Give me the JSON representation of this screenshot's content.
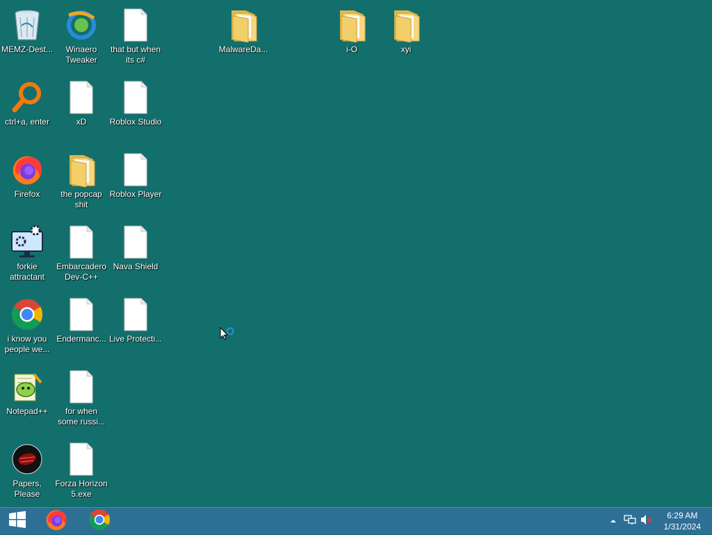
{
  "desktop": {
    "icons": [
      {
        "id": "recycle-bin",
        "label": "MEMZ-Dest...",
        "icon": "recycle-bin-icon"
      },
      {
        "id": "winaero-tweaker",
        "label": "Winaero Tweaker",
        "icon": "winaero-tweaker-icon"
      },
      {
        "id": "that-but-when",
        "label": "that but when its c#",
        "icon": "blank-file-icon"
      },
      {
        "id": "malwareda",
        "label": "MalwareDa...",
        "icon": "folder-icon"
      },
      {
        "id": "i-o",
        "label": "i-O",
        "icon": "folder-icon"
      },
      {
        "id": "xyi",
        "label": "xyi",
        "icon": "folder-icon"
      },
      {
        "id": "ctrl-a-enter",
        "label": "ctrl+a, enter",
        "icon": "magnifier-icon"
      },
      {
        "id": "xd",
        "label": "xD",
        "icon": "blank-file-icon"
      },
      {
        "id": "roblox-studio",
        "label": "Roblox Studio",
        "icon": "blank-file-icon"
      },
      {
        "id": "firefox",
        "label": "Firefox",
        "icon": "firefox-icon"
      },
      {
        "id": "popcap",
        "label": "the popcap shit",
        "icon": "folder-icon"
      },
      {
        "id": "roblox-player",
        "label": "Roblox Player",
        "icon": "blank-file-icon"
      },
      {
        "id": "forkie",
        "label": "forkie attractant",
        "icon": "monitor-gear-icon"
      },
      {
        "id": "embarcadero",
        "label": "Embarcadero Dev-C++",
        "icon": "blank-file-icon"
      },
      {
        "id": "nava-shield",
        "label": "Nava Shield",
        "icon": "blank-file-icon"
      },
      {
        "id": "chrome-desktop",
        "label": "i know you people we...",
        "icon": "chrome-icon"
      },
      {
        "id": "endermanc",
        "label": "Endermanc...",
        "icon": "blank-file-icon"
      },
      {
        "id": "live-protecti",
        "label": "Live Protecti...",
        "icon": "blank-file-icon"
      },
      {
        "id": "notepadpp",
        "label": "Notepad++",
        "icon": "notepadpp-icon"
      },
      {
        "id": "for-when-some",
        "label": "for when some russi...",
        "icon": "blank-file-icon"
      },
      {
        "id": "papers-please",
        "label": "Papers, Please",
        "icon": "papers-please-icon"
      },
      {
        "id": "forza",
        "label": "Forza Horizon 5.exe",
        "icon": "blank-file-icon"
      }
    ]
  },
  "taskbar": {
    "start": {
      "icon": "windows-start-icon"
    },
    "pinned": [
      {
        "id": "firefox",
        "icon": "firefox-icon"
      },
      {
        "id": "chrome",
        "icon": "chrome-icon"
      }
    ],
    "tray": {
      "chevron": "chevron-up-icon",
      "network": "network-icon",
      "volume": "volume-muted-icon"
    },
    "clock": {
      "time": "6:29 AM",
      "date": "1/31/2024"
    }
  },
  "colors": {
    "desktop_bg": "#126f6c",
    "taskbar_bg": "#2d6f95"
  }
}
